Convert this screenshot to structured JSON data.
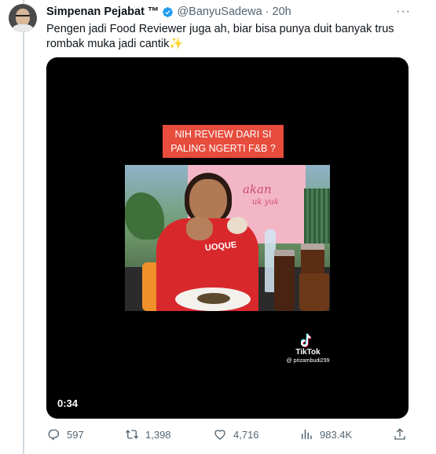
{
  "tweet": {
    "author_name": "Simpenan Pejabat ™",
    "author_handle": "@BanyuSadewa",
    "separator": "·",
    "time": "20h",
    "more_glyph": "···",
    "text_main": "Pengen jadi Food Reviewer juga ah, biar bisa punya duit banyak trus rombak muka jadi cantik",
    "text_emoji": "✨"
  },
  "media": {
    "caption_line1": "NIH REVIEW DARI SI",
    "caption_line2": "PALING NGERTI F&B ?",
    "tiktok_label": "TikTok",
    "tiktok_user": "@ prizambudi299",
    "duration": "0:34",
    "background_color": "#000000",
    "caption_color": "#e74c3c"
  },
  "actions": {
    "reply_count": "597",
    "retweet_count": "1,398",
    "like_count": "4,716",
    "view_count": "983.4K"
  },
  "icons": {
    "verified": "verified-badge-icon",
    "reply": "reply-icon",
    "retweet": "retweet-icon",
    "like": "heart-icon",
    "views": "views-icon",
    "share": "share-icon",
    "more": "more-icon"
  },
  "colors": {
    "text_primary": "#0f1419",
    "text_secondary": "#536471",
    "verified_blue": "#1d9bf0",
    "thread_line": "#cfd9de"
  }
}
